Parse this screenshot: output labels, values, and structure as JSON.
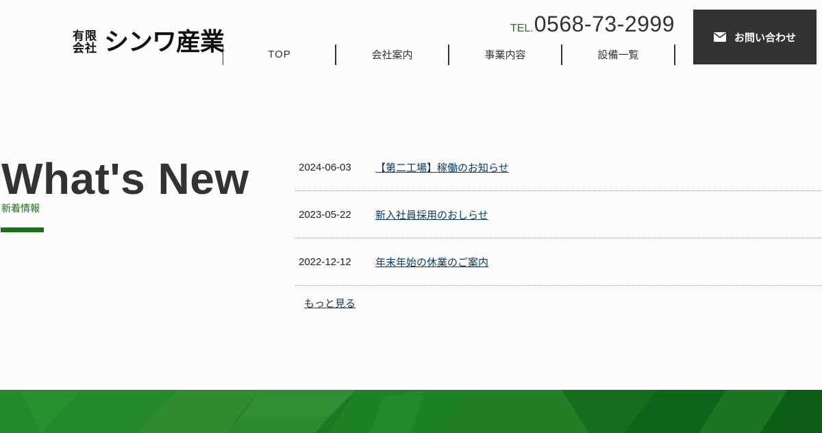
{
  "logo": {
    "small_top": "有限",
    "small_bottom": "会社",
    "name": "シンワ産業"
  },
  "header": {
    "tel_prefix": "TEL.",
    "tel_number": "0568-73-2999",
    "contact_label": "お問い合わせ",
    "contact_icon": "envelope-icon"
  },
  "nav": {
    "items": [
      {
        "label": "TOP"
      },
      {
        "label": "会社案内"
      },
      {
        "label": "事業内容"
      },
      {
        "label": "設備一覧"
      }
    ]
  },
  "news": {
    "title": "What's New",
    "subtitle": "新着情報",
    "items": [
      {
        "date": "2024-06-03",
        "title": "【第二工場】稼働のお知らせ"
      },
      {
        "date": "2023-05-22",
        "title": "新入社員採用のおしらせ"
      },
      {
        "date": "2022-12-12",
        "title": "年末年始の休業のご案内"
      }
    ],
    "more_label": "もっと見る"
  },
  "colors": {
    "accent_green": "#1e6e1e",
    "dark": "#333333",
    "link": "#0a3a5e",
    "footer_green": "#1a7a22"
  }
}
